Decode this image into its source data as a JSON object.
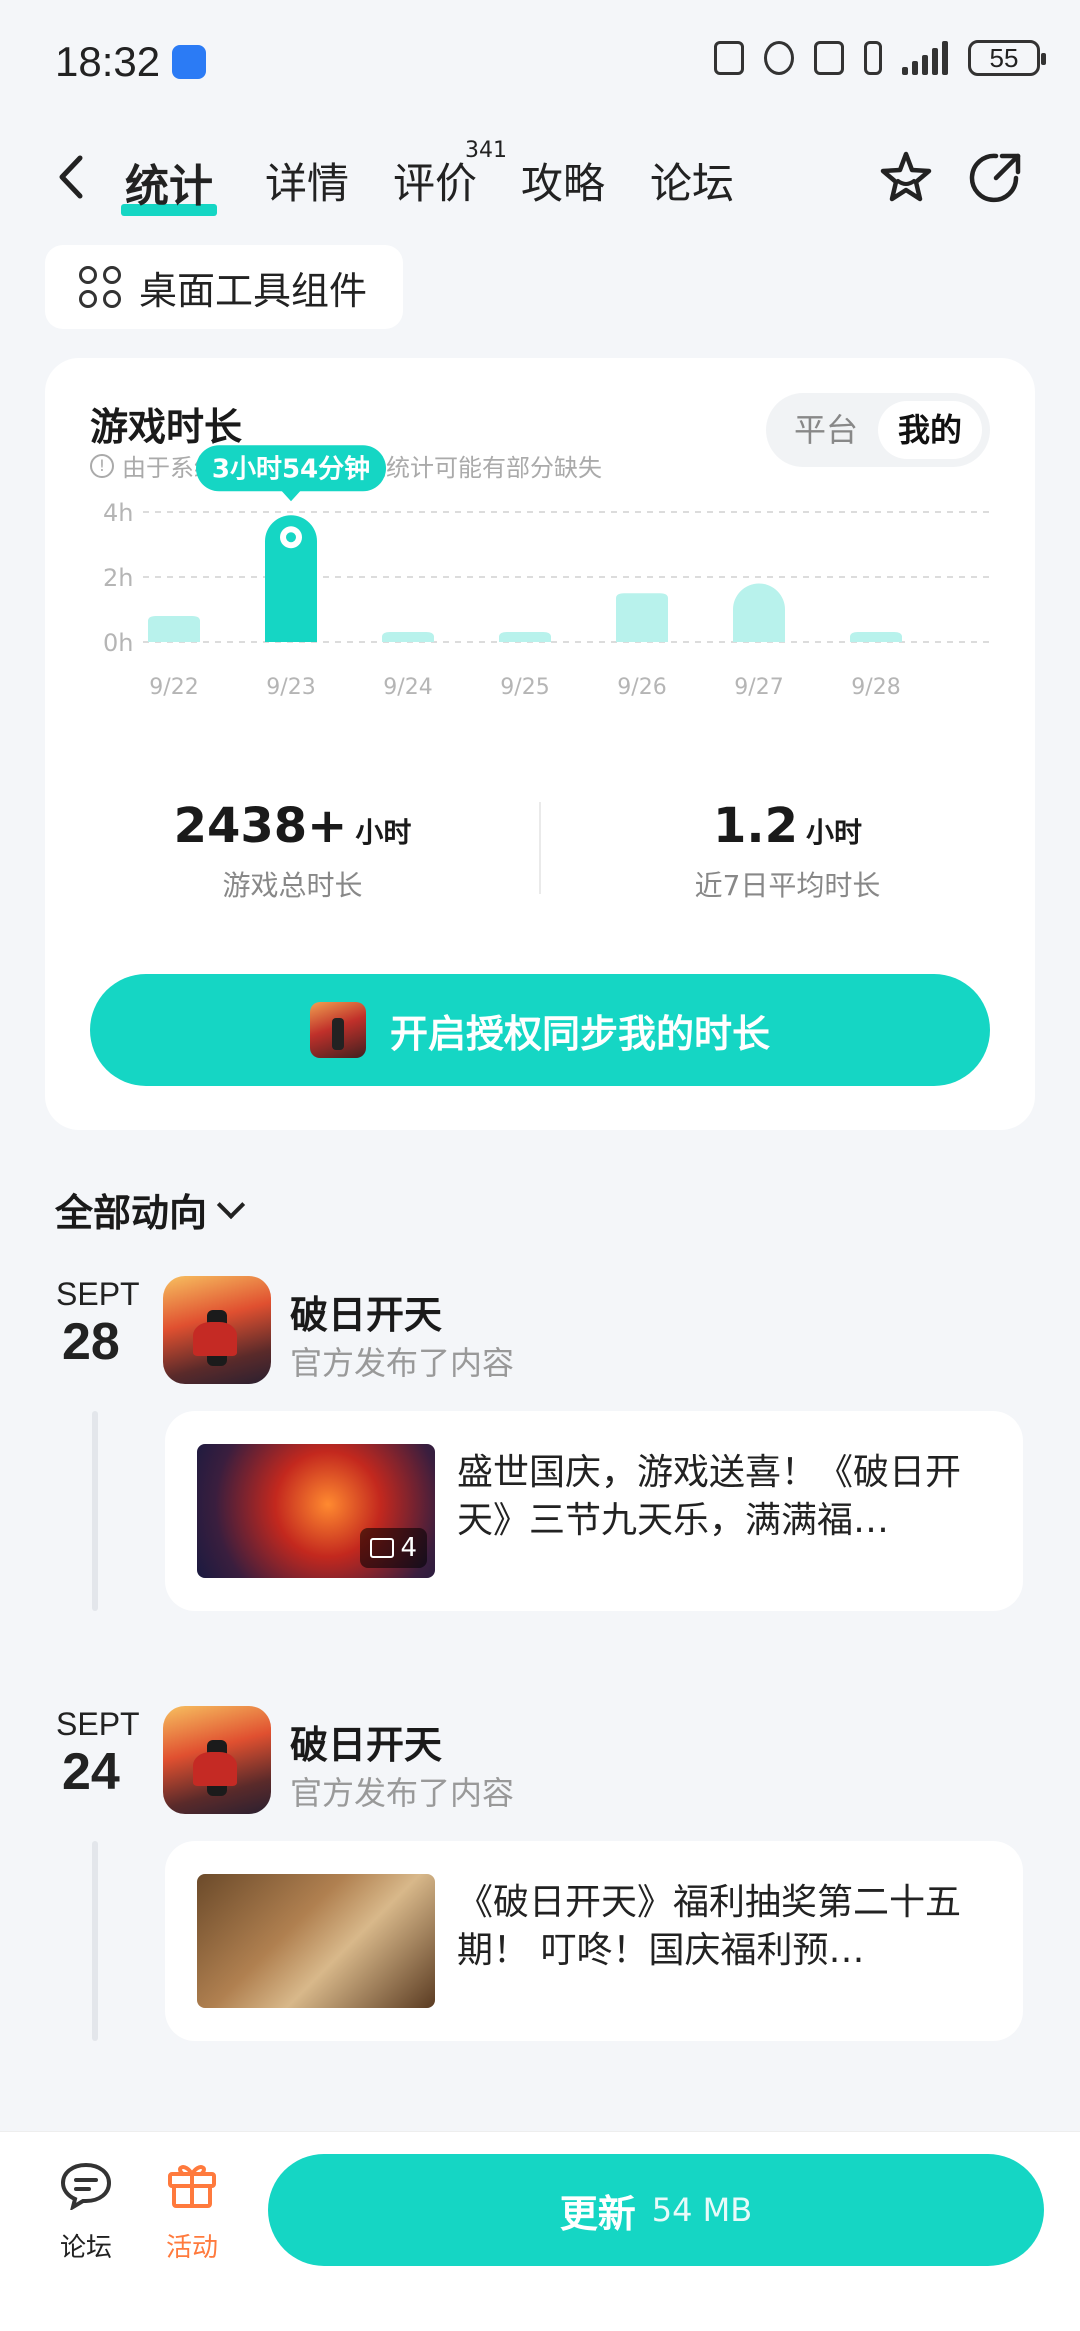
{
  "status_bar": {
    "time": "18:32",
    "battery": "55"
  },
  "nav": {
    "tabs": [
      {
        "label": "统计",
        "active": true
      },
      {
        "label": "详情"
      },
      {
        "label": "评价"
      },
      {
        "label": "攻略"
      },
      {
        "label": "论坛"
      }
    ],
    "review_count": "341"
  },
  "widget_chip": {
    "label": "桌面工具组件"
  },
  "playtime": {
    "title": "游戏时长",
    "note": "由于系统上报问题，时长统计可能有部分缺失",
    "toggle": [
      "平台",
      "我的"
    ],
    "toggle_selected": "我的",
    "tooltip": "3小时54分钟",
    "total_value": "2438+",
    "total_unit": "小时",
    "total_label": "游戏总时长",
    "avg_value": "1.2",
    "avg_unit": "小时",
    "avg_label": "近7日平均时长",
    "auth_button": "开启授权同步我的时长"
  },
  "chart_data": {
    "type": "bar",
    "categories": [
      "9/22",
      "9/23",
      "9/24",
      "9/25",
      "9/26",
      "9/27",
      "9/28"
    ],
    "values": [
      0.8,
      3.9,
      0.15,
      0.15,
      1.5,
      1.8,
      0.15
    ],
    "unit": "h",
    "y_ticks": [
      "0h",
      "2h",
      "4h"
    ],
    "ylim": [
      0,
      4
    ],
    "highlight_index": 1,
    "grid": true,
    "colors": {
      "bar": "#b8f2ec",
      "highlight": "#15d6c4"
    }
  },
  "feed": {
    "header": "全部动向",
    "posts": [
      {
        "month": "SEPT",
        "day": "28",
        "name": "破日开天",
        "sub": "官方发布了内容",
        "image_count": "4",
        "text": "盛世国庆，游戏送喜！《破日开天》三节九天乐，满满福…"
      },
      {
        "month": "SEPT",
        "day": "24",
        "name": "破日开天",
        "sub": "官方发布了内容",
        "text": "《破日开天》福利抽奖第二十五期！ 叮咚！国庆福利预…"
      }
    ]
  },
  "bottom_bar": {
    "forum": "论坛",
    "activity": "活动",
    "update_label": "更新",
    "update_size": "54 MB"
  },
  "colors": {
    "accent": "#15d6c4",
    "activity": "#ff7a3d"
  }
}
